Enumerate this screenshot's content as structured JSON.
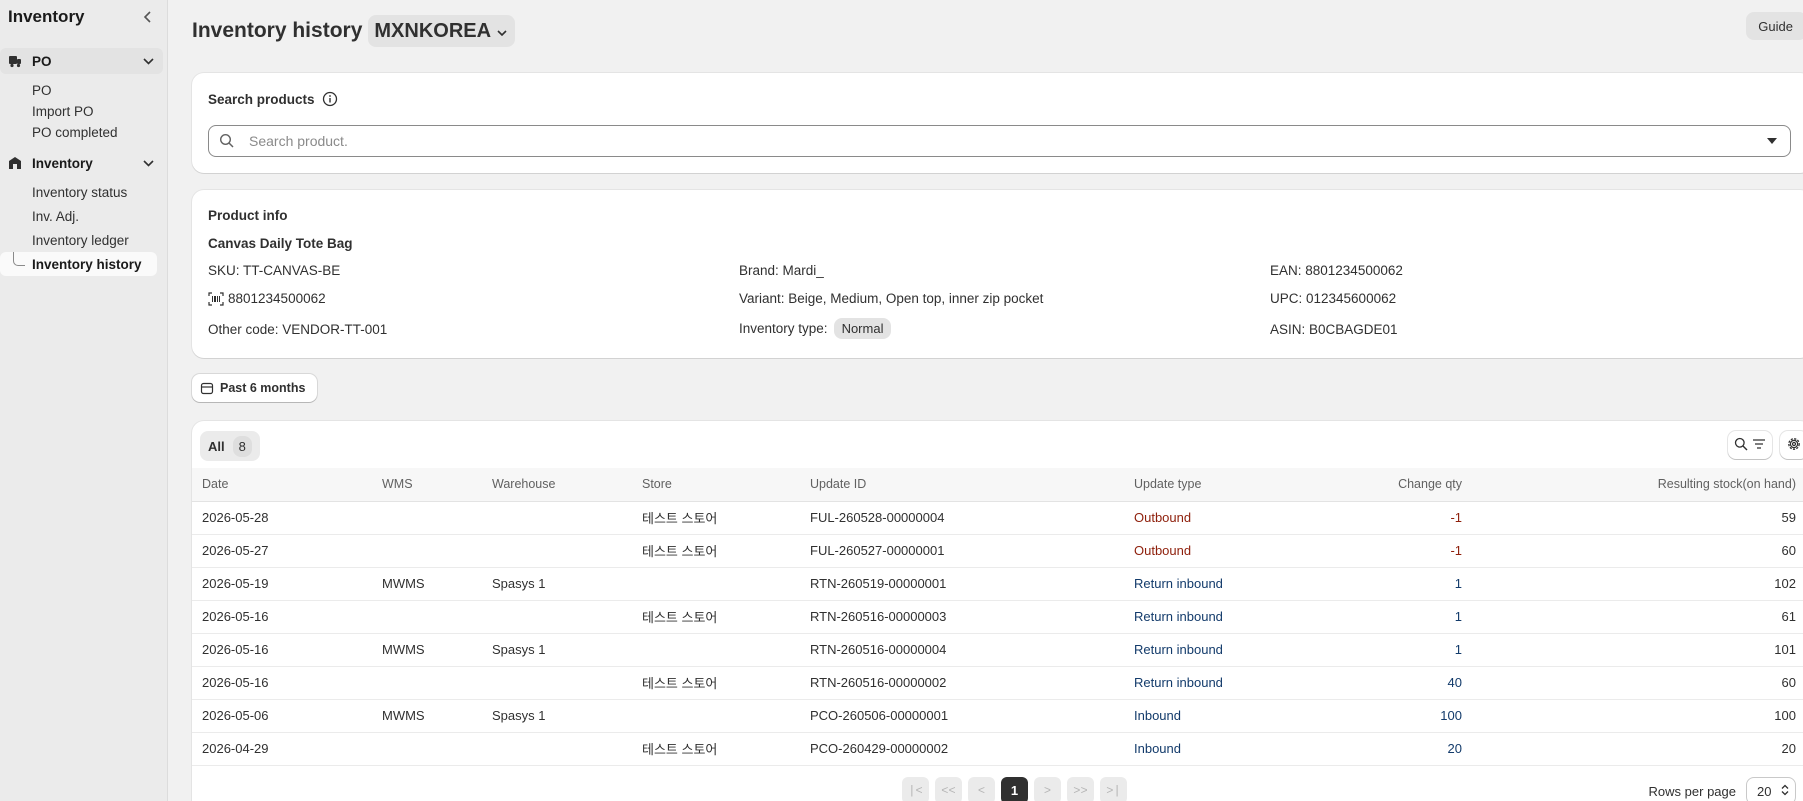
{
  "sidebar": {
    "title": "Inventory",
    "groups": [
      {
        "label": "PO",
        "items": [
          "PO",
          "Import PO",
          "PO completed"
        ]
      },
      {
        "label": "Inventory",
        "items": [
          "Inventory status",
          "Inv. Adj.",
          "Inventory ledger",
          "Inventory history"
        ]
      }
    ]
  },
  "header": {
    "title": "Inventory history",
    "store": "MXNKOREA",
    "guide_label": "Guide"
  },
  "search": {
    "label": "Search products",
    "placeholder": "Search product."
  },
  "product": {
    "section_title": "Product info",
    "name": "Canvas Daily Tote Bag",
    "sku": "SKU: TT-CANVAS-BE",
    "barcode": "8801234500062",
    "other_code": "Other code: VENDOR-TT-001",
    "brand": "Brand: Mardi_",
    "variant": "Variant: Beige, Medium, Open top, inner zip pocket",
    "inventory_type_label": "Inventory type:",
    "inventory_type": "Normal",
    "ean": "EAN: 8801234500062",
    "upc": "UPC: 012345600062",
    "asin": "ASIN: B0CBAGDE01"
  },
  "filter": {
    "date_range": "Past 6 months"
  },
  "table": {
    "tab_label": "All",
    "tab_count": "8",
    "columns": [
      "Date",
      "WMS",
      "Warehouse",
      "Store",
      "Update ID",
      "Update type",
      "Change qty",
      "Resulting stock(on hand)"
    ],
    "rows": [
      {
        "date": "2026-05-28",
        "wms": "",
        "warehouse": "",
        "store": "테스트 스토어",
        "update_id": "FUL-260528-00000004",
        "update_type": "Outbound",
        "change_qty": "-1",
        "result": "59"
      },
      {
        "date": "2026-05-27",
        "wms": "",
        "warehouse": "",
        "store": "테스트 스토어",
        "update_id": "FUL-260527-00000001",
        "update_type": "Outbound",
        "change_qty": "-1",
        "result": "60"
      },
      {
        "date": "2026-05-19",
        "wms": "MWMS",
        "warehouse": "Spasys 1",
        "store": "",
        "update_id": "RTN-260519-00000001",
        "update_type": "Return inbound",
        "change_qty": "1",
        "result": "102"
      },
      {
        "date": "2026-05-16",
        "wms": "",
        "warehouse": "",
        "store": "테스트 스토어",
        "update_id": "RTN-260516-00000003",
        "update_type": "Return inbound",
        "change_qty": "1",
        "result": "61"
      },
      {
        "date": "2026-05-16",
        "wms": "MWMS",
        "warehouse": "Spasys 1",
        "store": "",
        "update_id": "RTN-260516-00000004",
        "update_type": "Return inbound",
        "change_qty": "1",
        "result": "101"
      },
      {
        "date": "2026-05-16",
        "wms": "",
        "warehouse": "",
        "store": "테스트 스토어",
        "update_id": "RTN-260516-00000002",
        "update_type": "Return inbound",
        "change_qty": "40",
        "result": "60"
      },
      {
        "date": "2026-05-06",
        "wms": "MWMS",
        "warehouse": "Spasys 1",
        "store": "",
        "update_id": "PCO-260506-00000001",
        "update_type": "Inbound",
        "change_qty": "100",
        "result": "100"
      },
      {
        "date": "2026-04-29",
        "wms": "",
        "warehouse": "",
        "store": "테스트 스토어",
        "update_id": "PCO-260429-00000002",
        "update_type": "Inbound",
        "change_qty": "20",
        "result": "20"
      }
    ]
  },
  "pagination": {
    "first": "|<",
    "prev_many": "<<",
    "prev": "<",
    "current": "1",
    "next": ">",
    "next_many": ">>",
    "last": ">|",
    "rows_label": "Rows per page",
    "rows_value": "20"
  },
  "colors": {
    "outbound": "#8e1f0b",
    "inbound": "#133b6b",
    "active_bg": "#fafafa"
  }
}
